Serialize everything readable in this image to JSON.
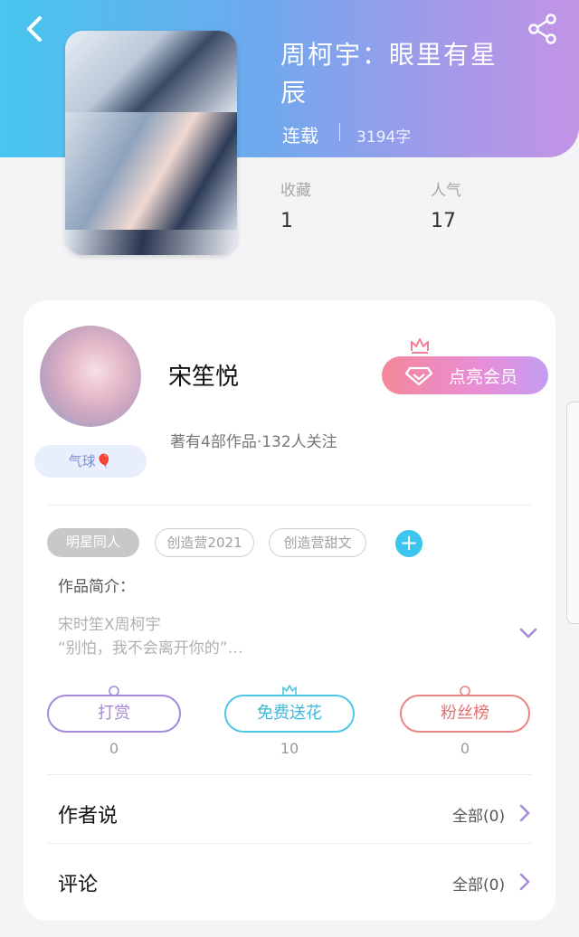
{
  "header": {
    "title": "周柯宇：眼里有星辰",
    "status": "连载",
    "word_count": "3194字",
    "stats": [
      {
        "label": "收藏",
        "value": "1"
      },
      {
        "label": "人气",
        "value": "17"
      }
    ]
  },
  "author": {
    "name": "宋笙悦",
    "description": "著有4部作品·132人关注",
    "badge": "气球🎈",
    "vip_label": "点亮会员"
  },
  "tags": [
    "明星同人",
    "创造营2021",
    "创造营甜文"
  ],
  "intro": {
    "label": "作品简介：",
    "lines": [
      "宋时笙X周柯宇",
      "“别怕，我不会离开你的”…"
    ]
  },
  "actions": [
    {
      "label": "打赏",
      "count": "0",
      "color": "#a48ad9"
    },
    {
      "label": "免费送花",
      "count": "10",
      "color": "#4bc7e6"
    },
    {
      "label": "粉丝榜",
      "count": "0",
      "color": "#e88485"
    }
  ],
  "rows": [
    {
      "title": "作者说",
      "link": "全部(0)"
    },
    {
      "title": "评论",
      "link": "全部(0)"
    }
  ],
  "icons": {
    "back": "chevron-left-icon",
    "share": "share-icon",
    "crown": "crown-icon",
    "diamond": "diamond-icon",
    "expand": "chevron-down-icon",
    "row_arrow": "chevron-right-icon"
  },
  "colors": {
    "accent_blue": "#3cc6ef",
    "accent_purple": "#a48ad9",
    "vip_gradient_start": "#f4879a",
    "vip_gradient_end": "#c49cf1"
  }
}
